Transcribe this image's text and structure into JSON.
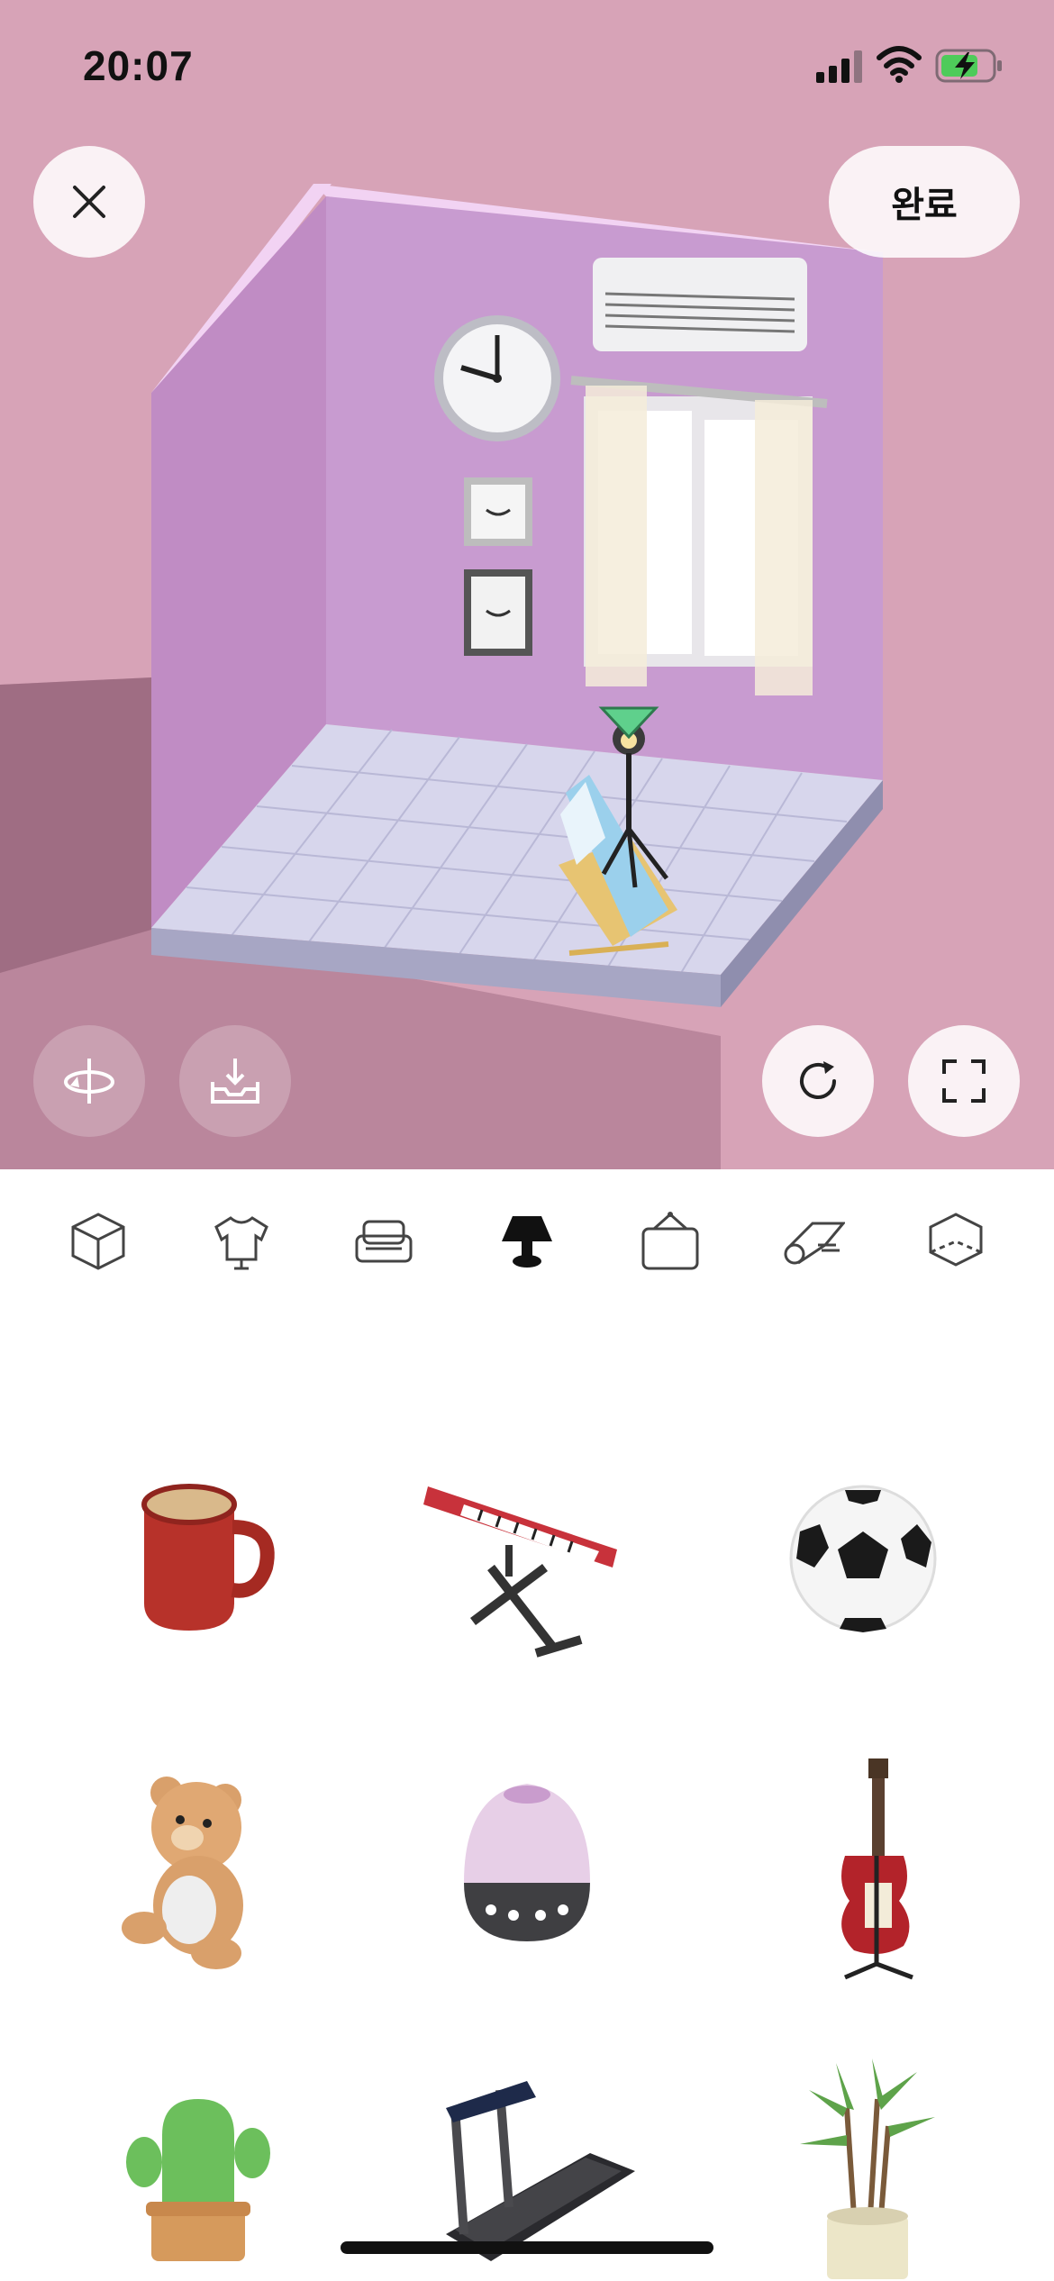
{
  "status_bar": {
    "time": "20:07"
  },
  "header": {
    "done_label": "완료"
  },
  "colors": {
    "background": "#d7a3b7",
    "wall": "#c896cc",
    "floor": "#d9d9ee",
    "accent_marker": "#5fd08c"
  },
  "controls": {
    "close_icon": "close-icon",
    "rotate_view_icon": "rotate-view-icon",
    "save_icon": "save-tray-icon",
    "refresh_icon": "refresh-icon",
    "expand_icon": "expand-icon"
  },
  "categories": [
    {
      "name": "room-structure",
      "icon": "cube-icon",
      "selected": false
    },
    {
      "name": "clothing",
      "icon": "shirt-icon",
      "selected": false
    },
    {
      "name": "furniture",
      "icon": "sofa-icon",
      "selected": false
    },
    {
      "name": "lighting-and-props",
      "icon": "lamp-icon",
      "selected": true
    },
    {
      "name": "wall-decor",
      "icon": "frame-icon",
      "selected": false
    },
    {
      "name": "rug",
      "icon": "rug-roll-icon",
      "selected": false
    },
    {
      "name": "floor",
      "icon": "floor-tile-icon",
      "selected": false
    }
  ],
  "items": [
    {
      "name": "mug"
    },
    {
      "name": "keyboard-stand"
    },
    {
      "name": "soccer-ball"
    },
    {
      "name": "teddy-bear"
    },
    {
      "name": "egg-lamp"
    },
    {
      "name": "guitar-stand"
    },
    {
      "name": "cactus"
    },
    {
      "name": "treadmill"
    },
    {
      "name": "potted-plant"
    }
  ]
}
